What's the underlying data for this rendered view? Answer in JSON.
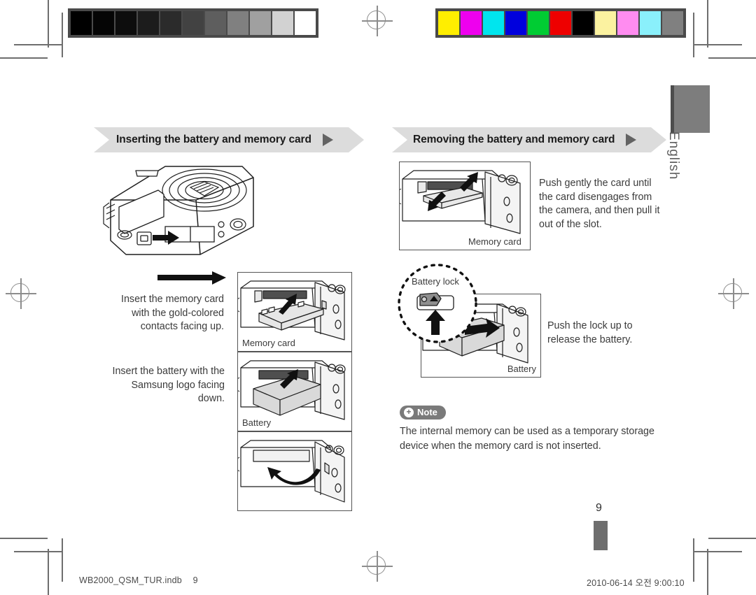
{
  "document": {
    "language_tab": "English",
    "page_number": "9"
  },
  "calibration": {
    "grayscale_label": "grayscale-calibration-strip",
    "grayscale_swatches": [
      "#000000",
      "#050505",
      "#0d0d0d",
      "#1c1c1c",
      "#2b2b2b",
      "#424242",
      "#5e5e5e",
      "#808080",
      "#a0a0a0",
      "#d2d2d2",
      "#ffffff"
    ],
    "color_label": "color-calibration-strip",
    "color_swatches": [
      "#ffee00",
      "#ee00ee",
      "#00e5ee",
      "#0000dd",
      "#00cc33",
      "#ee0000",
      "#000000",
      "#fbf2a0",
      "#ff8cf0",
      "#8af0fb",
      "#808080"
    ]
  },
  "sections": {
    "left": {
      "title": "Inserting the battery and memory card",
      "paragraphs": [
        "Insert the memory card with the gold-colored contacts facing up.",
        "Insert the battery with the Samsung logo facing down."
      ],
      "figure_labels": [
        "Memory card",
        "Battery"
      ]
    },
    "right": {
      "title": "Removing the battery and memory card",
      "paragraphs": [
        "Push gently the card until the card disengages from the camera, and then pull it out of the slot.",
        "Push the lock up to release the battery."
      ],
      "figure_labels": [
        "Memory card",
        "Battery lock",
        "Battery"
      ]
    }
  },
  "note": {
    "badge_label": "Note",
    "badge_icon": "plus-circle-icon",
    "text": "The internal memory can be used as a temporary storage device when the memory card is not inserted."
  },
  "footer": {
    "file_name": "WB2000_QSM_TUR.indb",
    "file_page": "9",
    "timestamp": "2010-06-14   오전 9:00:10"
  }
}
